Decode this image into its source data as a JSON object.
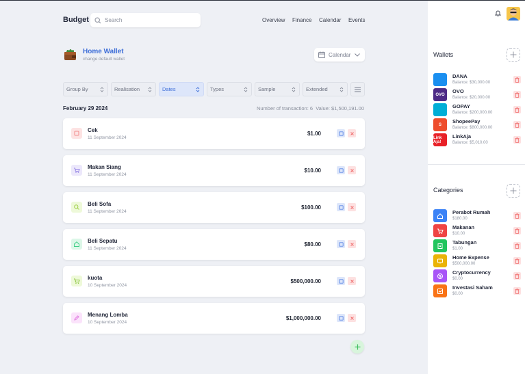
{
  "header": {
    "brand": "Budget",
    "search_placeholder": "Search",
    "nav": [
      "Overview",
      "Finance",
      "Calendar",
      "Events"
    ]
  },
  "wallet": {
    "title": "Home Wallet",
    "subtitle": "change default wallet",
    "calendar_label": "Calendar"
  },
  "filters": [
    "Group By",
    "Realisation",
    "Dates",
    "Types",
    "Sample",
    "Extended"
  ],
  "summary": {
    "date": "February 29 2024",
    "count_text": "Number of transaction: 6",
    "value_text": "Value: $1,500,191.00"
  },
  "transactions": [
    {
      "name": "Cek",
      "date": "11 September 2024",
      "amount": "$1.00",
      "color": "#fde3e3",
      "icon_color": "#f28c8c",
      "icon": "square-icon"
    },
    {
      "name": "Makan Siang",
      "date": "11 September 2024",
      "amount": "$10.00",
      "color": "#ece8fb",
      "icon_color": "#9b8be6",
      "icon": "cart-icon"
    },
    {
      "name": "Beli Sofa",
      "date": "11 September 2024",
      "amount": "$100.00",
      "color": "#eef9d9",
      "icon_color": "#9fd048",
      "icon": "search-icon"
    },
    {
      "name": "Beli Sepatu",
      "date": "11 September 2024",
      "amount": "$80.00",
      "color": "#dcf7e8",
      "icon_color": "#3fcf86",
      "icon": "home-icon"
    },
    {
      "name": "kuota",
      "date": "10 September 2024",
      "amount": "$500,000.00",
      "color": "#eef9d9",
      "icon_color": "#8cc63f",
      "icon": "cart-icon"
    },
    {
      "name": "Menang Lomba",
      "date": "10 September 2024",
      "amount": "$1,000,000.00",
      "color": "#fbe3fb",
      "icon_color": "#e07be0",
      "icon": "edit-icon"
    }
  ],
  "sidebar": {
    "wallets_title": "Wallets",
    "categories_title": "Categories",
    "wallets": [
      {
        "name": "DANA",
        "balance": "Balance: $30,000.00",
        "color": "#1a8ff0",
        "logo": ""
      },
      {
        "name": "OVO",
        "balance": "Balance: $20,000.00",
        "color": "#4c2a86",
        "logo": "OVO"
      },
      {
        "name": "GOPAY",
        "balance": "Balance: $200,000.00",
        "color": "#00aed6",
        "logo": ""
      },
      {
        "name": "ShopeePay",
        "balance": "Balance: $800,000.00",
        "color": "#ee4d2d",
        "logo": "S"
      },
      {
        "name": "LinkAja",
        "balance": "Balance: $5,010.00",
        "color": "#e82127",
        "logo": "Link Aja!"
      }
    ],
    "categories": [
      {
        "name": "Perabot Rumah",
        "amount": "$180.00",
        "color": "#3b82f6",
        "icon": "home-icon"
      },
      {
        "name": "Makanan",
        "amount": "$10.00",
        "color": "#ef4444",
        "icon": "cart-icon"
      },
      {
        "name": "Tabungan",
        "amount": "$1.00",
        "color": "#22c55e",
        "icon": "building-icon"
      },
      {
        "name": "Home Expense",
        "amount": "$500,000.00",
        "color": "#eab308",
        "icon": "monitor-icon"
      },
      {
        "name": "Cryptocurrency",
        "amount": "$0.00",
        "color": "#a855f7",
        "icon": "coin-icon"
      },
      {
        "name": "Investasi Saham",
        "amount": "$0.00",
        "color": "#f97316",
        "icon": "chart-icon"
      }
    ]
  }
}
